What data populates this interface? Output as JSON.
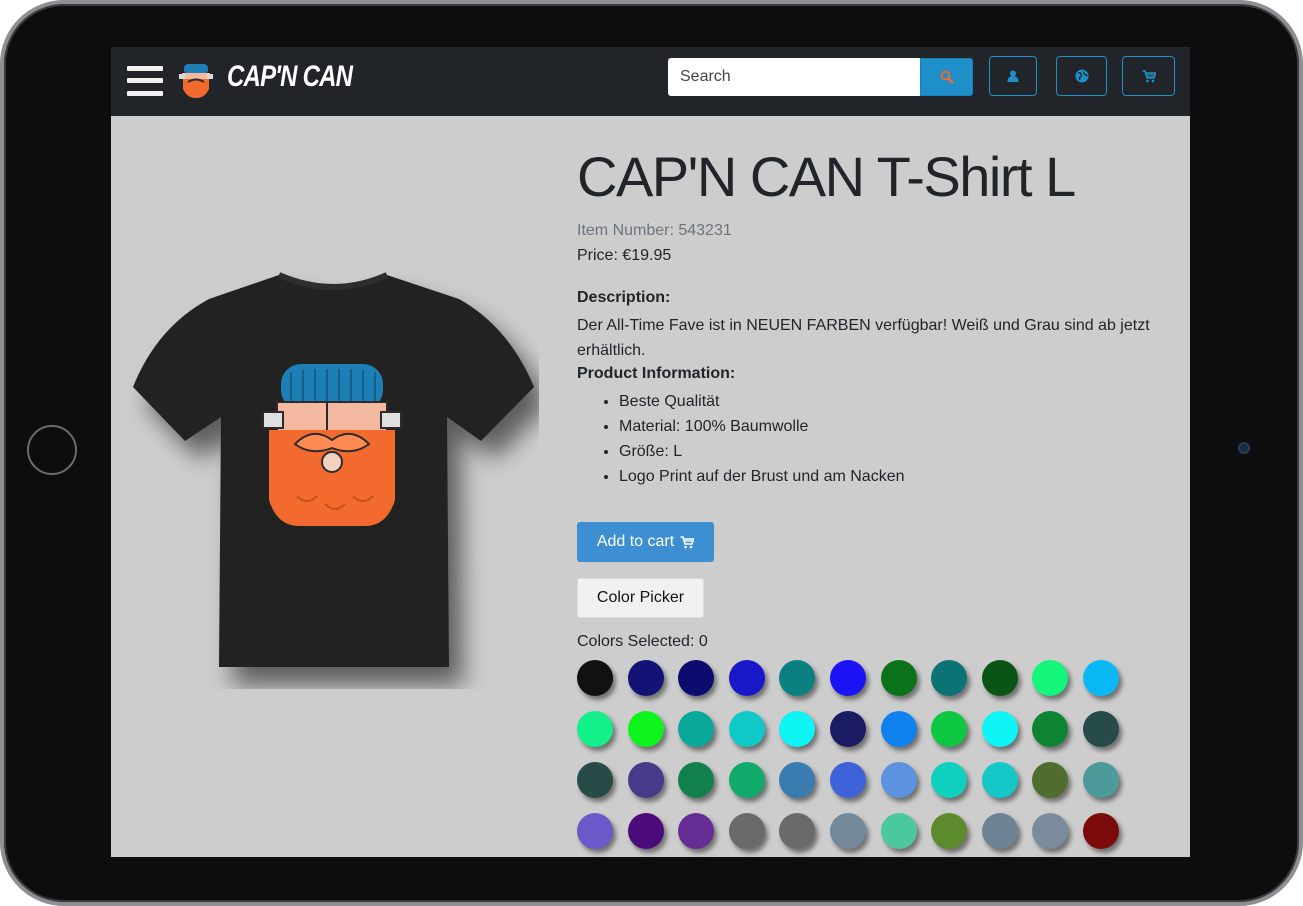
{
  "brand": {
    "name": "CAP'N CAN"
  },
  "search": {
    "placeholder": "Search"
  },
  "product": {
    "title": "CAP'N CAN T-Shirt L",
    "item_number": "Item Number: 543231",
    "price": "Price: €19.95",
    "description_heading": "Description:",
    "description": "Der All-Time Fave ist in NEUEN FARBEN verfügbar! Weiß und Grau sind ab jetzt erhältlich.",
    "info_heading": "Product Information:",
    "info_items": [
      "Beste Qualität",
      "Material: 100% Baumwolle",
      "Größe: L",
      "Logo Print auf der Brust und am Nacken"
    ]
  },
  "actions": {
    "add_to_cart": "Add to cart",
    "color_picker": "Color Picker",
    "colors_selected": "Colors Selected: 0"
  },
  "icons": {
    "menu": "hamburger-menu-icon",
    "search": "search-icon",
    "user": "user-icon",
    "globe": "globe-icon",
    "cart": "cart-icon"
  },
  "theme": {
    "navbar_bg": "#212529",
    "accent": "#1f8fc9",
    "page_bg": "#cdcdcd",
    "primary_button": "#3d8fd1",
    "search_icon_color": "#f26a2e"
  },
  "swatches": [
    "#111111",
    "#131375",
    "#0c0c6e",
    "#1818c8",
    "#0b8080",
    "#1a14f5",
    "#0a7319",
    "#0b7373",
    "#0a5516",
    "#13f57b",
    "#0ab8f5",
    "#13f08a",
    "#0ef51e",
    "#0aa89a",
    "#0fc8c8",
    "#0ff5f5",
    "#1b1b63",
    "#0f82f0",
    "#0dc840",
    "#0ff5f5",
    "#0c8431",
    "#264b48",
    "#284b47",
    "#463b88",
    "#11804d",
    "#10aa6c",
    "#3a7bb0",
    "#3d63d8",
    "#5b93e0",
    "#10d0c0",
    "#14c8c8",
    "#4f6d2e",
    "#4e9a9a",
    "#6a59c9",
    "#4b0b7b",
    "#662d94",
    "#6a6a6a",
    "#6a6a6a",
    "#74889a",
    "#4cc8a0",
    "#5e8a2e",
    "#6e8296",
    "#7a8c9c",
    "#7b0a0a"
  ]
}
